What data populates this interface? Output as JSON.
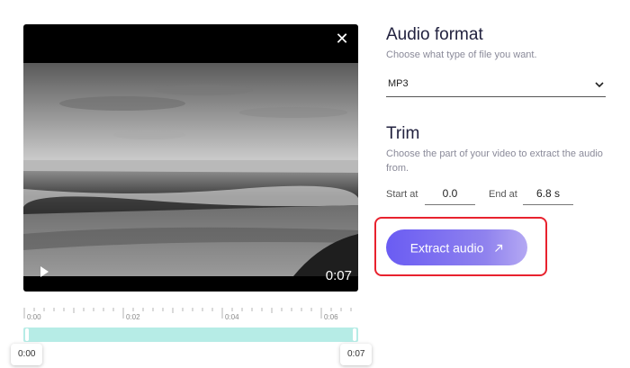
{
  "player": {
    "current_time": "0:07",
    "close_icon": "close-icon",
    "play_icon": "play-icon"
  },
  "timeline": {
    "ticks": [
      "0:00",
      "0:02",
      "0:04",
      "0:06"
    ],
    "range_color": "#b6ece6",
    "start_chip": "0:00",
    "end_chip": "0:07"
  },
  "audio_format": {
    "title": "Audio format",
    "subtitle": "Choose what type of file you want.",
    "selected": "MP3"
  },
  "trim": {
    "title": "Trim",
    "subtitle": "Choose the part of your video to extract the audio from.",
    "start_label": "Start at",
    "start_value": "0.0",
    "end_label": "End at",
    "end_value": "6.8 s"
  },
  "extract": {
    "label": "Extract audio",
    "icon": "arrow-up-right-icon",
    "highlight_color": "#e8222e"
  }
}
